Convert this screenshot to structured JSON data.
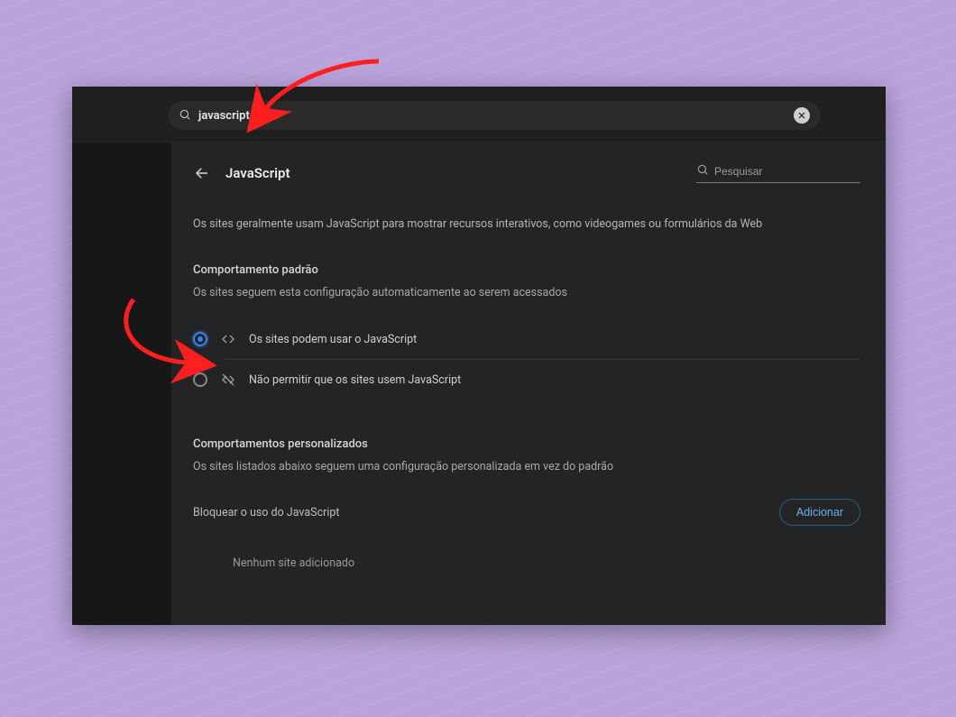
{
  "searchbar": {
    "query": "javascript"
  },
  "page": {
    "title": "JavaScript",
    "search_placeholder": "Pesquisar",
    "description": "Os sites geralmente usam JavaScript para mostrar recursos interativos, como videogames ou formulários da Web"
  },
  "default_behavior": {
    "title": "Comportamento padrão",
    "subtitle": "Os sites seguem esta configuração automaticamente ao serem acessados",
    "options": {
      "allow": "Os sites podem usar o JavaScript",
      "deny": "Não permitir que os sites usem JavaScript"
    }
  },
  "custom_behavior": {
    "title": "Comportamentos personalizados",
    "subtitle": "Os sites listados abaixo seguem uma configuração personalizada em vez do padrão",
    "block_label": "Bloquear o uso do JavaScript",
    "add_button": "Adicionar",
    "empty": "Nenhum site adicionado"
  }
}
